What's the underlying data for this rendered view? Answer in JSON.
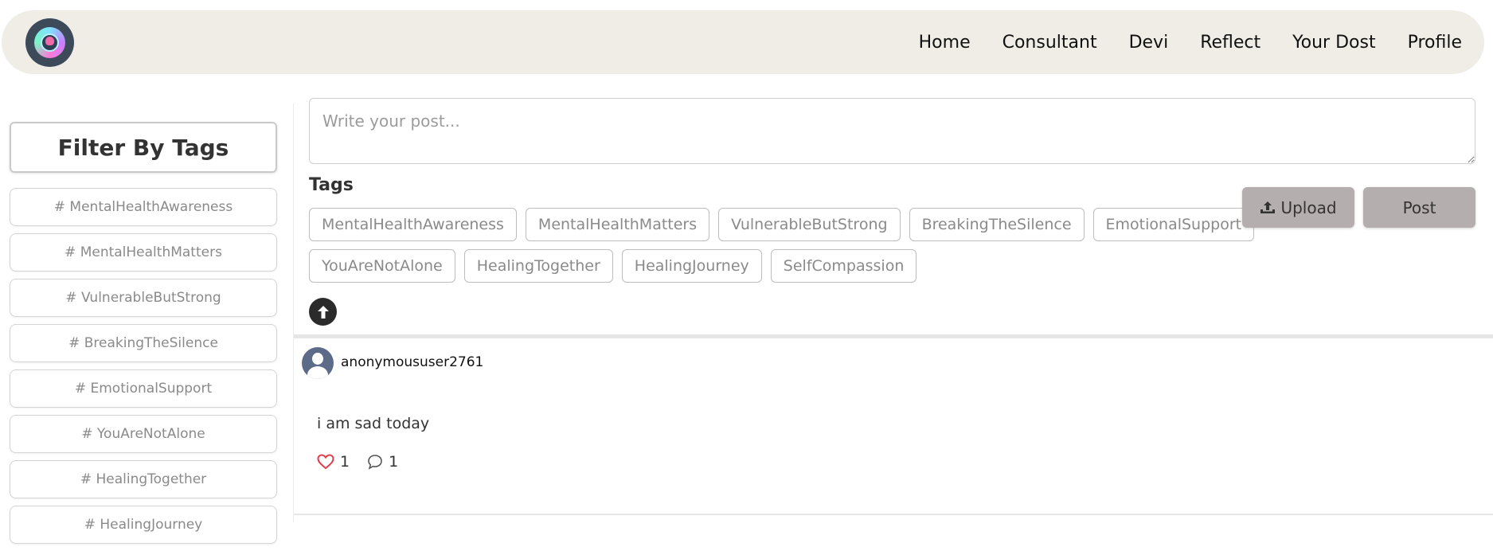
{
  "nav": {
    "items": [
      {
        "label": "Home"
      },
      {
        "label": "Consultant"
      },
      {
        "label": "Devi"
      },
      {
        "label": "Reflect"
      },
      {
        "label": "Your Dost"
      },
      {
        "label": "Profile"
      }
    ]
  },
  "sidebar": {
    "title": "Filter By Tags",
    "items": [
      {
        "label": "# MentalHealthAwareness"
      },
      {
        "label": "# MentalHealthMatters"
      },
      {
        "label": "# VulnerableButStrong"
      },
      {
        "label": "# BreakingTheSilence"
      },
      {
        "label": "# EmotionalSupport"
      },
      {
        "label": "# YouAreNotAlone"
      },
      {
        "label": "# HealingTogether"
      },
      {
        "label": "# HealingJourney"
      }
    ]
  },
  "composer": {
    "placeholder": "Write your post...",
    "tags_label": "Tags",
    "tags_row1": [
      {
        "label": "MentalHealthAwareness"
      },
      {
        "label": "MentalHealthMatters"
      },
      {
        "label": "VulnerableButStrong"
      },
      {
        "label": "BreakingTheSilence"
      },
      {
        "label": "EmotionalSupport"
      }
    ],
    "tags_row2": [
      {
        "label": "YouAreNotAlone"
      },
      {
        "label": "HealingTogether"
      },
      {
        "label": "HealingJourney"
      },
      {
        "label": "SelfCompassion"
      }
    ],
    "upload_label": "Upload",
    "post_label": "Post"
  },
  "feed": {
    "post": {
      "username": "anonymoususer2761",
      "text": "i am sad today",
      "likes": "1",
      "comments": "1"
    }
  },
  "colors": {
    "navbar_bg": "#efede6",
    "button_bg": "#b5aeae",
    "like_red": "#e23b4a"
  }
}
